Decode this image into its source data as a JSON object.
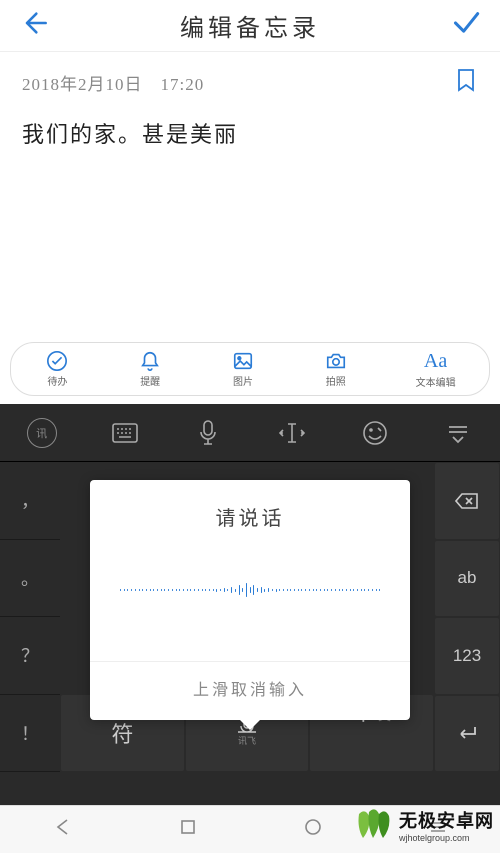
{
  "header": {
    "title": "编辑备忘录"
  },
  "note": {
    "timestamp": "2018年2月10日　17:20",
    "text": "我们的家。甚是美丽"
  },
  "toolbar": {
    "items": [
      {
        "label": "待办"
      },
      {
        "label": "提醒"
      },
      {
        "label": "图片"
      },
      {
        "label": "拍照"
      },
      {
        "label": "文本编辑"
      }
    ],
    "text_edit_glyph": "Aa"
  },
  "keyboard": {
    "logo_text": "讯",
    "left_keys": [
      "，",
      "。",
      "？",
      "！"
    ],
    "right_keys": {
      "ab": "ab",
      "num": "123"
    },
    "bottom": {
      "symbol": "符",
      "voice_sub": "讯飞",
      "lang_main": "中",
      "lang_sub": "/英"
    }
  },
  "voice_popup": {
    "title": "请说话",
    "hint": "上滑取消输入"
  },
  "watermark": {
    "cn": "无极安卓网",
    "en": "wjhotelgroup.com"
  }
}
